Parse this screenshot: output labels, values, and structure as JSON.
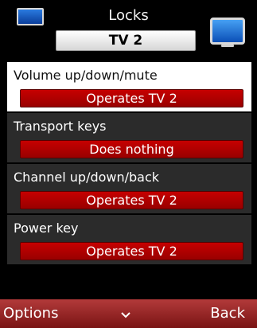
{
  "header": {
    "title": "Locks",
    "subtitle": "TV 2",
    "left_icon": "tv-icon",
    "right_icon": "tv-icon"
  },
  "list": {
    "items": [
      {
        "label": "Volume up/down/mute",
        "value": "Operates TV 2",
        "selected": true
      },
      {
        "label": "Transport keys",
        "value": "Does nothing",
        "selected": false
      },
      {
        "label": "Channel up/down/back",
        "value": "Operates TV 2",
        "selected": false
      },
      {
        "label": "Power key",
        "value": "Operates TV 2",
        "selected": false
      }
    ]
  },
  "softkeys": {
    "left": "Options",
    "center_icon": "chevron-down-icon",
    "right": "Back"
  },
  "colors": {
    "value_red": "#b80000",
    "softkey_bar": "#9c2a2a",
    "item_bg": "#2b2b2b",
    "selected_bg": "#ffffff"
  }
}
